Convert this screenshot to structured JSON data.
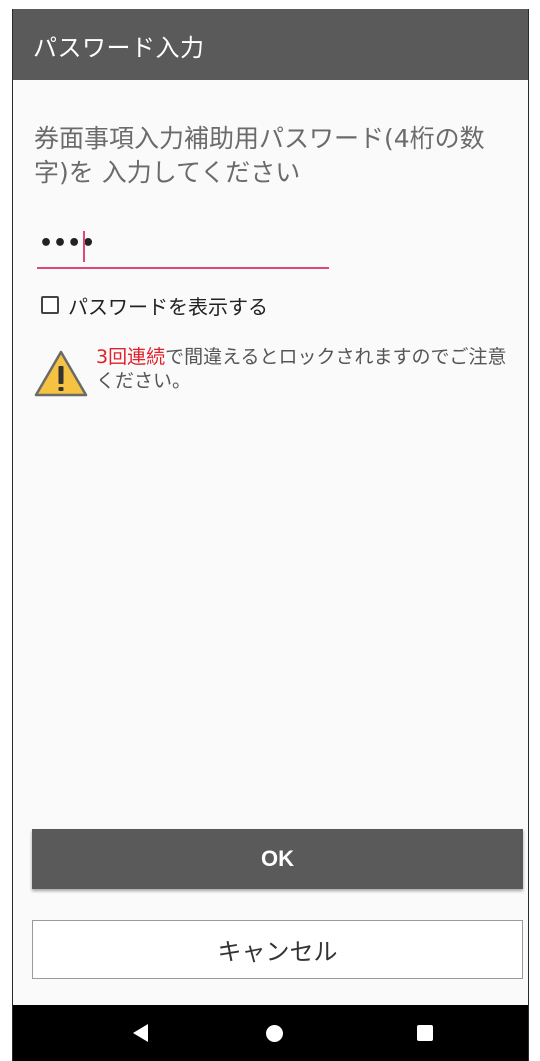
{
  "app_bar": {
    "title": "パスワード入力"
  },
  "prompt": {
    "text": "券面事項入力補助用パスワード(4桁の数字)を 入力してください"
  },
  "password_field": {
    "value": "••••"
  },
  "show_password": {
    "label": "パスワードを表示する",
    "checked": false
  },
  "warning": {
    "icon": "warning-triangle-icon",
    "highlight": "3回連続",
    "text": "で間違えるとロックされますのでご注意ください。"
  },
  "buttons": {
    "ok_label": "OK",
    "cancel_label": "キャンセル"
  },
  "nav_bar": {
    "back_icon": "back-triangle-icon",
    "home_icon": "home-circle-icon",
    "recents_icon": "recents-square-icon"
  },
  "colors": {
    "app_bar": "#5a5a5a",
    "accent": "#e0457b",
    "warning_red": "#e0202a",
    "warning_yellow": "#f5c242"
  }
}
